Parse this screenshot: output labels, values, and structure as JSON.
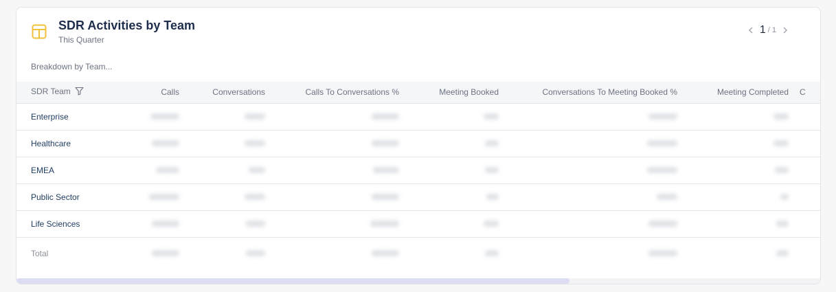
{
  "widget": {
    "title": "SDR Activities by Team",
    "subtitle": "This Quarter",
    "breakdown_label": "Breakdown by Team...",
    "accent_color": "#f0c23a"
  },
  "pager": {
    "current": "1",
    "total": "/ 1"
  },
  "table": {
    "columns": [
      "SDR Team",
      "Calls",
      "Conversations",
      "Calls To Conversations %",
      "Meeting Booked",
      "Conversations To Meeting Booked %",
      "Meeting Completed",
      "C"
    ],
    "rows": [
      {
        "team": "Enterprise"
      },
      {
        "team": "Healthcare"
      },
      {
        "team": "EMEA"
      },
      {
        "team": "Public Sector"
      },
      {
        "team": "Life Sciences"
      }
    ],
    "total_label": "Total"
  },
  "icons": {
    "widget": "table-icon",
    "filter": "filter-icon",
    "prev": "chevron-left-icon",
    "next": "chevron-right-icon"
  }
}
